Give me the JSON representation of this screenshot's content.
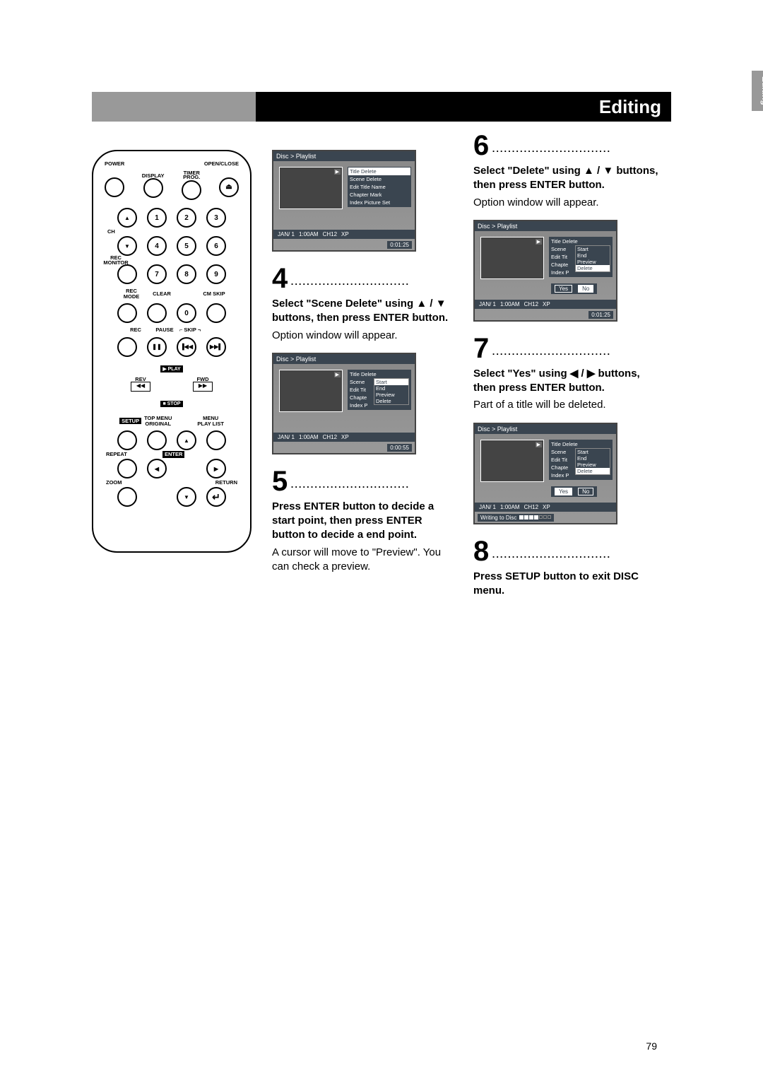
{
  "page": {
    "sectionTitle": "Editing",
    "sideTab": "Editing",
    "number": "79"
  },
  "remote": {
    "labels": {
      "power": "POWER",
      "openclose": "OPEN/CLOSE",
      "display": "DISPLAY",
      "timer": "TIMER",
      "prog": "PROG.",
      "ch": "CH",
      "recmonitor": "REC MONITOR",
      "recmode": "REC MODE",
      "clear": "CLEAR",
      "cmskip": "CM SKIP",
      "rec": "REC",
      "pause": "PAUSE",
      "skip": "SKIP",
      "rev": "REV",
      "play": "PLAY",
      "fwd": "FWD",
      "stop": "STOP",
      "setup": "SETUP",
      "topmenu": "TOP MENU",
      "original": "ORIGINAL",
      "menu": "MENU",
      "playlist": "PLAY LIST",
      "repeat": "REPEAT",
      "enter": "ENTER",
      "zoom": "ZOOM",
      "return": "RETURN"
    },
    "digits": [
      "1",
      "2",
      "3",
      "4",
      "5",
      "6",
      "7",
      "8",
      "9",
      "0"
    ]
  },
  "osd": {
    "breadcrumb": "Disc > Playlist",
    "menu1": [
      "Title Delete",
      "Scene Delete",
      "Edit Title Name",
      "Chapter Mark",
      "Index Picture Set"
    ],
    "menuShort": [
      "Title Delete",
      "Scene",
      "Edit Tit",
      "Chapte",
      "Index P"
    ],
    "sub": [
      "Start",
      "End",
      "Preview",
      "Delete"
    ],
    "confirm": {
      "yes": "Yes",
      "no": "No"
    },
    "status1": {
      "date": "JAN/ 1",
      "time": "1:00AM",
      "ch": "CH12",
      "mode": "XP"
    },
    "counter1": "0:01:25",
    "counter2": "0:00:55",
    "writing": "Writing to Disc"
  },
  "steps": {
    "s4": {
      "num": "4",
      "instr_a": "Select \"Scene Delete\" using",
      "instr_b": " buttons, then press ENTER button.",
      "desc": "Option window will appear."
    },
    "s5": {
      "num": "5",
      "instr": "Press ENTER button to decide a start point, then press ENTER button to decide a end point.",
      "desc": "A cursor will move to \"Preview\". You can check a preview."
    },
    "s6": {
      "num": "6",
      "instr_a": "Select \"Delete\" using ",
      "instr_b": " buttons, then press ENTER button.",
      "desc": "Option window will appear."
    },
    "s7": {
      "num": "7",
      "instr_a": "Select \"Yes\" using ",
      "instr_b": " buttons, then press ENTER button.",
      "desc": "Part of a title will be deleted."
    },
    "s8": {
      "num": "8",
      "instr": "Press SETUP button to exit DISC menu."
    }
  }
}
